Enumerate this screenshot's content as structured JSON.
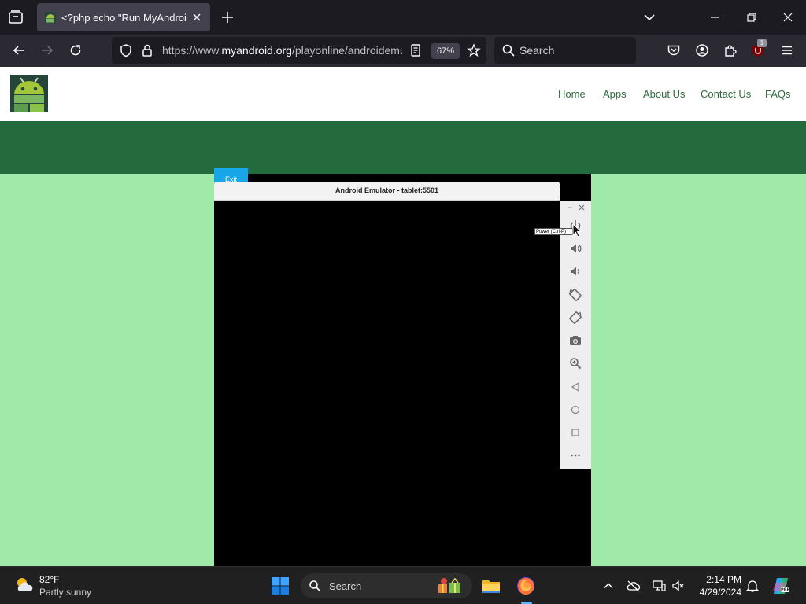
{
  "browser": {
    "tab": {
      "title": "<?php echo \"Run MyAndroid\"; ?>"
    },
    "url": {
      "prefix": "https://www.",
      "domain": "myandroid.org",
      "path": "/playonline/androidemulator.php"
    },
    "zoom": "67%",
    "search_placeholder": "Search",
    "extension_badge": "1"
  },
  "site": {
    "nav": [
      "Home",
      "Apps",
      "About Us",
      "Contact Us",
      "FAQs"
    ],
    "exit_label": "Exit",
    "emulator_title": "Android Emulator - tablet:5501",
    "tooltip": "Power (Ctrl-P)",
    "accent": "#236b3c",
    "background": "#a0eaa9"
  },
  "taskbar": {
    "temperature": "82°F",
    "condition": "Partly sunny",
    "search_placeholder": "Search",
    "time": "2:14 PM",
    "date": "4/29/2024"
  }
}
